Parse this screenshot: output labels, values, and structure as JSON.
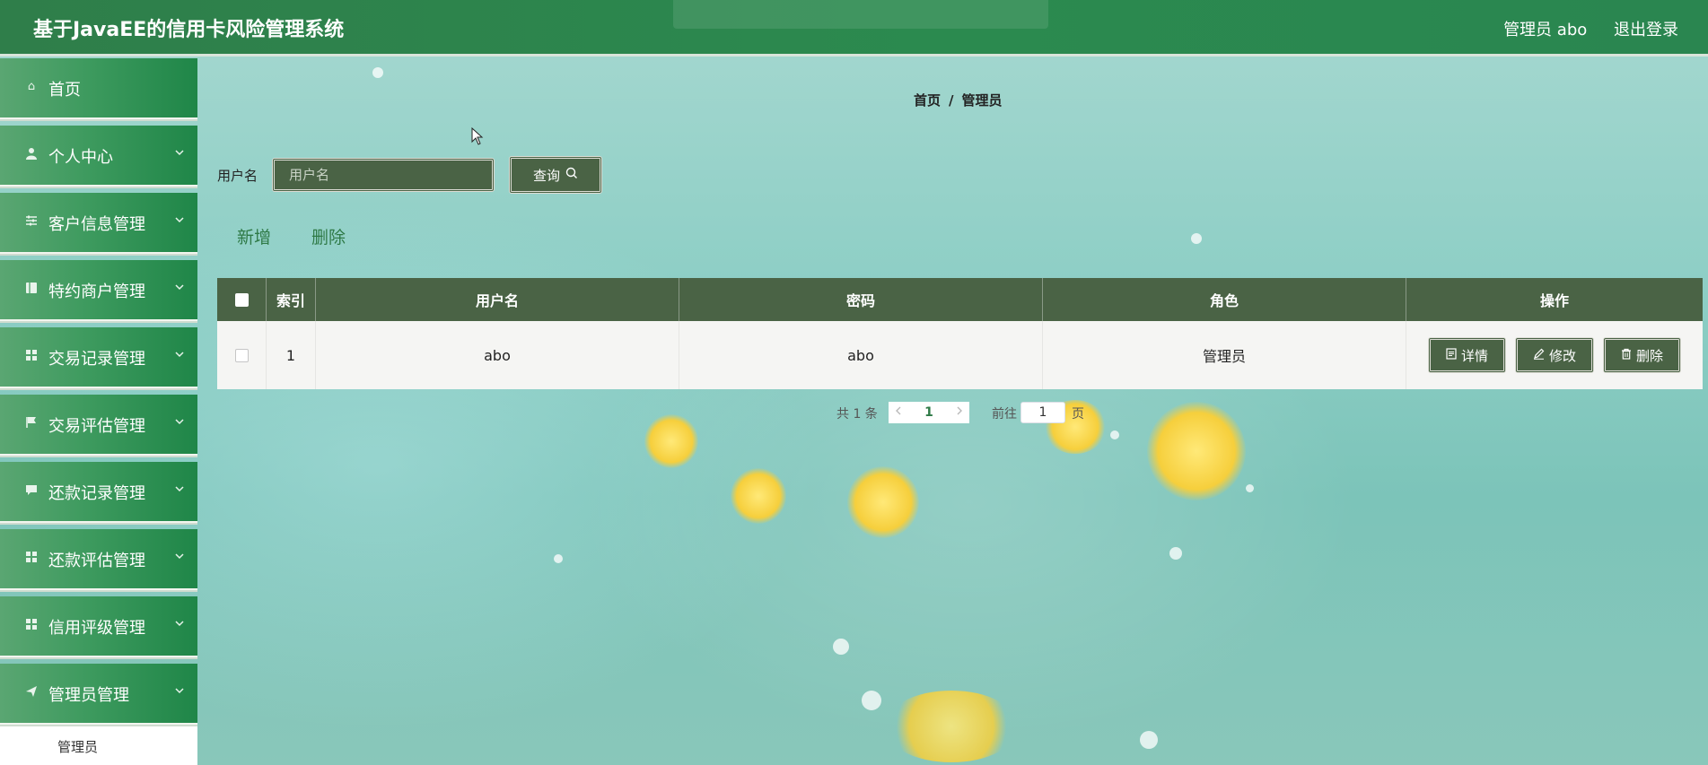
{
  "header": {
    "title": "基于JavaEE的信用卡风险管理系统",
    "user": "管理员 abo",
    "logout": "退出登录"
  },
  "sidebar": {
    "items": [
      {
        "label": "首页",
        "icon": "home-icon",
        "has_arrow": false
      },
      {
        "label": "个人中心",
        "icon": "user-icon",
        "has_arrow": true
      },
      {
        "label": "客户信息管理",
        "icon": "sliders-icon",
        "has_arrow": true
      },
      {
        "label": "特约商户管理",
        "icon": "book-icon",
        "has_arrow": true
      },
      {
        "label": "交易记录管理",
        "icon": "grid-icon",
        "has_arrow": true
      },
      {
        "label": "交易评估管理",
        "icon": "flag-icon",
        "has_arrow": true
      },
      {
        "label": "还款记录管理",
        "icon": "message-icon",
        "has_arrow": true
      },
      {
        "label": "还款评估管理",
        "icon": "grid-icon",
        "has_arrow": true
      },
      {
        "label": "信用评级管理",
        "icon": "grid-icon",
        "has_arrow": true
      },
      {
        "label": "管理员管理",
        "icon": "send-icon",
        "has_arrow": true
      }
    ],
    "submenu": [
      "管理员"
    ]
  },
  "breadcrumb": {
    "home": "首页",
    "sep": "/",
    "current": "管理员"
  },
  "search": {
    "label": "用户名",
    "placeholder": "用户名",
    "value": "",
    "button": "查询"
  },
  "actions": {
    "add": "新增",
    "delete": "删除"
  },
  "table": {
    "columns": [
      "索引",
      "用户名",
      "密码",
      "角色",
      "操作"
    ],
    "rows": [
      {
        "index": "1",
        "username": "abo",
        "password": "abo",
        "role": "管理员"
      }
    ],
    "row_actions": {
      "detail": "详情",
      "edit": "修改",
      "delete": "删除"
    }
  },
  "pagination": {
    "total": "共 1 条",
    "current_page": "1",
    "goto_label": "前往",
    "goto_value": "1",
    "page_suffix": "页"
  },
  "colors": {
    "header_bg": "#2b8a4f",
    "menu_bg": "#3d9a5e",
    "table_header": "#4a6345",
    "accent_text": "#2f7a47"
  }
}
